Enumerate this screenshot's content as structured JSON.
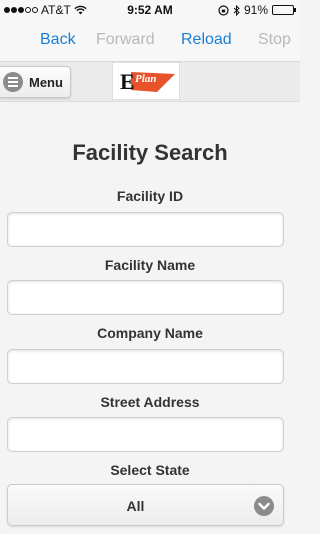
{
  "status_bar": {
    "carrier": "AT&T",
    "time": "9:52 AM",
    "battery": "91%",
    "battery_level": 0.91
  },
  "browser_nav": {
    "back": "Back",
    "forward": "Forward",
    "reload": "Reload",
    "stop": "Stop"
  },
  "header": {
    "menu_label": "Menu",
    "logo": {
      "letter": "E",
      "text": "Plan",
      "flag_color": "#e8532b"
    }
  },
  "form": {
    "title": "Facility Search",
    "fields": [
      {
        "label": "Facility ID",
        "value": ""
      },
      {
        "label": "Facility Name",
        "value": ""
      },
      {
        "label": "Company Name",
        "value": ""
      },
      {
        "label": "Street Address",
        "value": ""
      }
    ],
    "state": {
      "label": "Select State",
      "selected": "All"
    }
  },
  "colors": {
    "link": "#1a7fd4",
    "disabled": "#b8b8b8",
    "heading": "#333333"
  }
}
